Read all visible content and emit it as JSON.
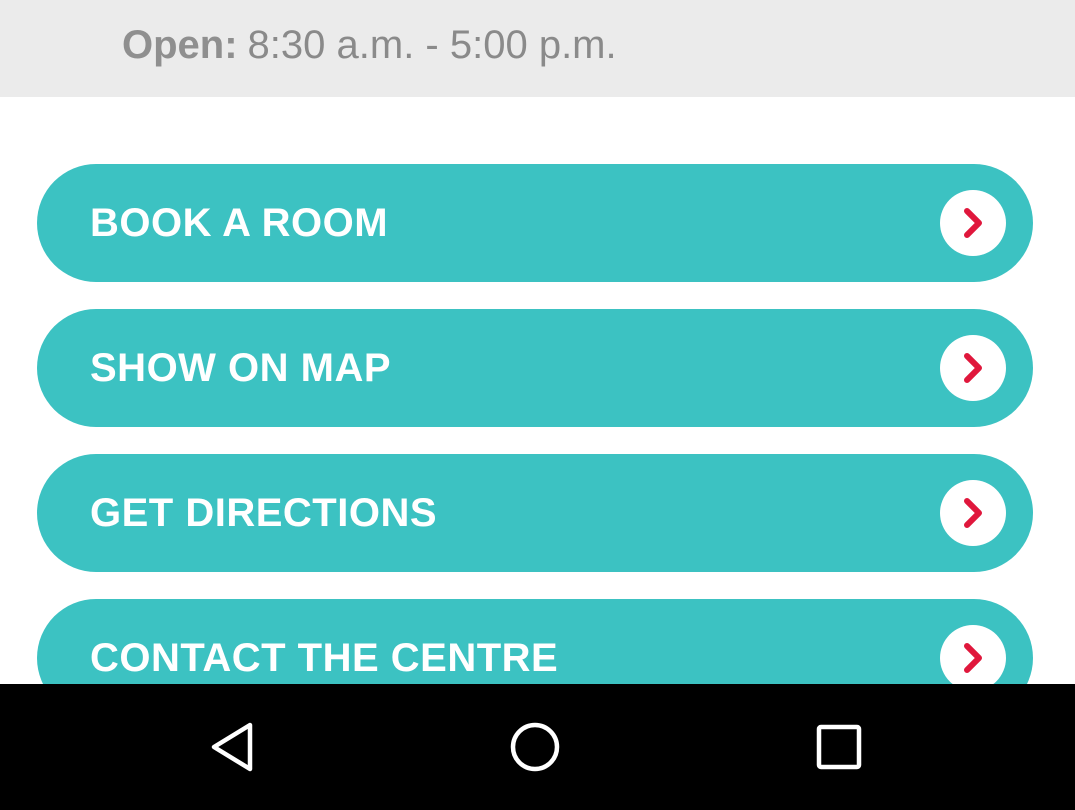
{
  "hours": {
    "label": "Open:",
    "value": "8:30 a.m. - 5:00 p.m."
  },
  "actions": [
    {
      "label": "BOOK A ROOM",
      "icon": "chevron-right-icon"
    },
    {
      "label": "SHOW ON MAP",
      "icon": "chevron-right-icon"
    },
    {
      "label": "GET DIRECTIONS",
      "icon": "chevron-right-icon"
    },
    {
      "label": "CONTACT THE CENTRE",
      "icon": "chevron-right-icon"
    }
  ],
  "nav": {
    "back_icon": "back-triangle-icon",
    "home_icon": "home-circle-icon",
    "recents_icon": "recents-square-icon"
  },
  "colors": {
    "accent": "#3cc2c2",
    "chevron": "#e0173c",
    "hours_bar": "#ebebeb",
    "nav_bar": "#000000"
  }
}
